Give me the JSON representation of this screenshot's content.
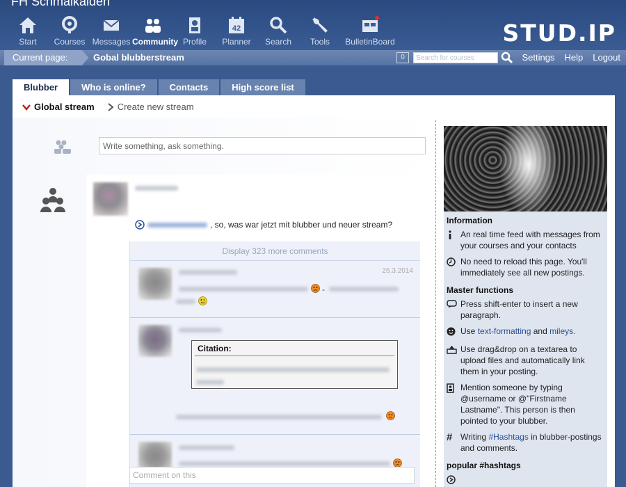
{
  "header": {
    "site_title": "FH Schmalkalden",
    "logo": "STUD.IP",
    "nav": [
      {
        "label": "Start",
        "icon": "home-icon"
      },
      {
        "label": "Courses",
        "icon": "courses-icon"
      },
      {
        "label": "Messages",
        "icon": "envelope-icon"
      },
      {
        "label": "Community",
        "icon": "community-icon",
        "active": true
      },
      {
        "label": "Profile",
        "icon": "profile-icon"
      },
      {
        "label": "Planner",
        "icon": "calendar-icon",
        "badge": "42"
      },
      {
        "label": "Search",
        "icon": "search-icon"
      },
      {
        "label": "Tools",
        "icon": "wrench-icon"
      },
      {
        "label": "BulletinBoard",
        "icon": "bulletin-icon"
      }
    ]
  },
  "breadcrumb": {
    "label": "Current page:",
    "current": "Gobal blubberstream",
    "count": "0",
    "search_placeholder": "Search for courses",
    "links": [
      "Settings",
      "Help",
      "Logout"
    ]
  },
  "tabs": [
    "Blubber",
    "Who is online?",
    "Contacts",
    "High score list"
  ],
  "subnav": {
    "active": "Global stream",
    "other": "Create new stream"
  },
  "compose": {
    "placeholder": "Write something, ask something."
  },
  "post": {
    "text": ", so, was war jetzt mit blubber und neuer stream?",
    "more_comments": "Display 323 more comments",
    "first_comment_date": "26.3.2014",
    "citation_title": "Citation:",
    "comment_placeholder": "Comment on this"
  },
  "sidebar": {
    "info_title": "Information",
    "info_items": [
      {
        "icon": "info-icon",
        "text": "An real time feed with messages from your courses and your contacts"
      },
      {
        "icon": "clock-icon",
        "text": "No need to reload this page. You'll immediately see all new postings."
      }
    ],
    "master_title": "Master functions",
    "shift_text": "Press shift-enter to insert a new paragraph.",
    "use_prefix": "Use",
    "text_formatting_link": "text-formatting",
    "and_word": "and",
    "smileys_link": "mileys.",
    "drag_text": "Use drag&drop on a textarea to upload files and automatically link them in your posting.",
    "mention_text": "Mention someone by typing @username or @\"Firstname Lastname\". This person is then pointed to your blubber.",
    "writing_prefix": "Writing",
    "hashtags_link": "#Hashtags",
    "hashtags_suffix": "in blubber-postings and comments.",
    "popular_title": "popular #hashtags"
  },
  "colors": {
    "header": "#2a4a7f",
    "breadcrumb": "#5e7aa8",
    "tab": "#6983b0",
    "link": "#2a4f95",
    "sidebar": "#dfe5ef"
  }
}
